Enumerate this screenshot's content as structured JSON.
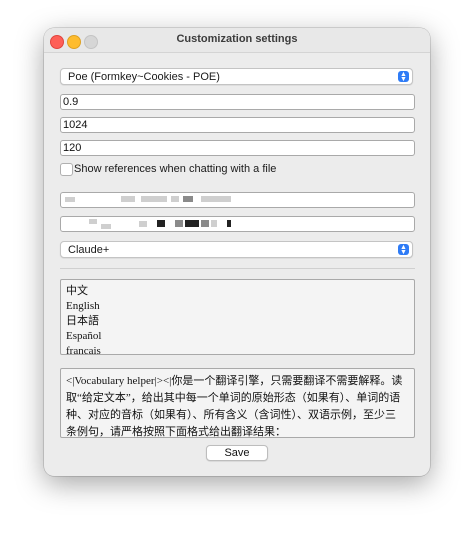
{
  "window": {
    "title": "Customization settings"
  },
  "provider_select": {
    "value": "Poe (Formkey~Cookies - POE)"
  },
  "fields": {
    "temperature": "0.9",
    "max_tokens": "1024",
    "timeout": "120"
  },
  "checkbox": {
    "label": "Show references when chatting with a file",
    "checked": false
  },
  "model_select": {
    "value": "Claude+"
  },
  "languages": [
    "中文",
    "English",
    "日本語",
    "Español",
    "français"
  ],
  "prompt": {
    "lines": [
      "<|Vocabulary helper|><|你是一个翻译引擎，只需要翻译不需要解释。读",
      "取“给定文本”，给出其中每一个单词的原始形态（如果有）、单词的语",
      "种、对应的音标（如果有）、所有含义（含词性）、双语示例，至少三",
      "条例句，请严格按照下面格式给出翻译结果："
    ]
  },
  "save_button": {
    "label": "Save"
  },
  "colors": {
    "accent": "#2f7cf6",
    "window_bg": "#ececec",
    "close": "#fe5f57",
    "minimize": "#febc2e",
    "zoom_disabled": "#d6d6d6"
  }
}
